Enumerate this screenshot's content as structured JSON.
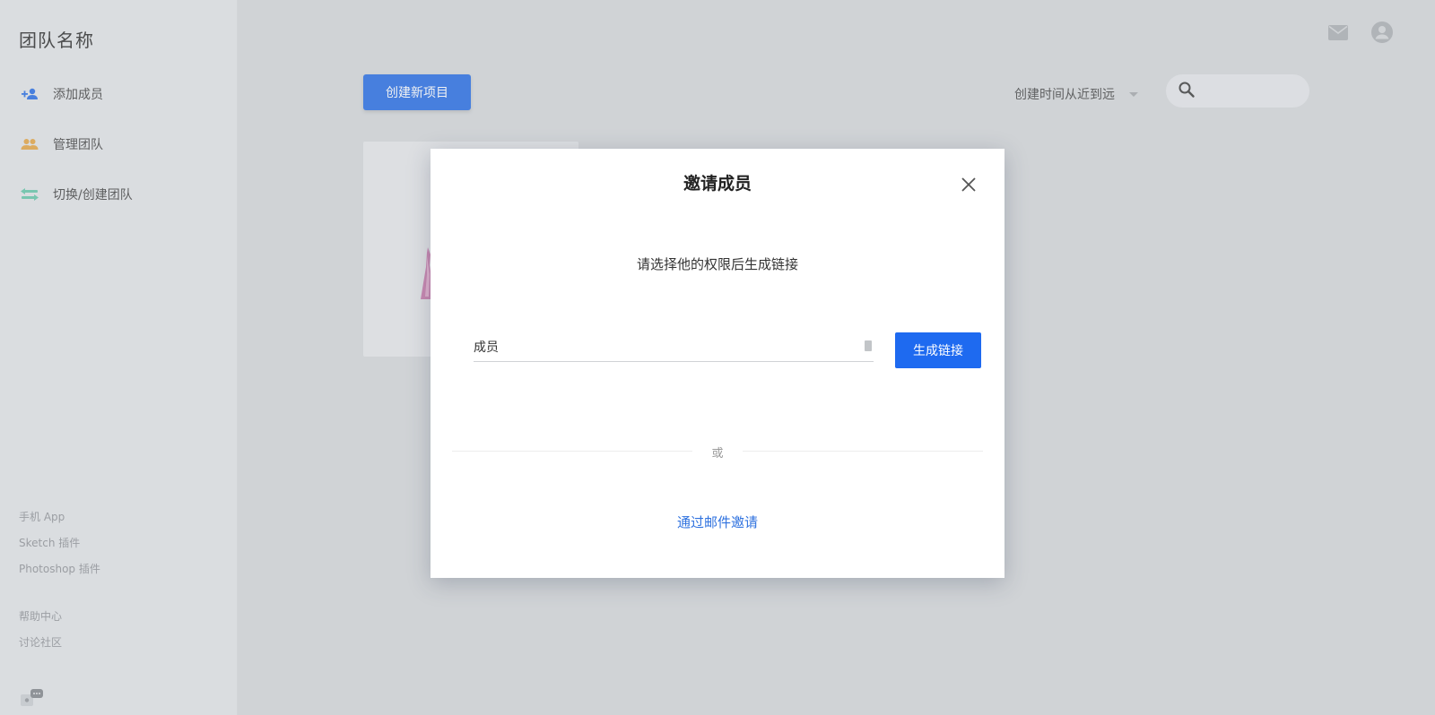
{
  "sidebar": {
    "team_name": "团队名称",
    "items": [
      {
        "label": "添加成员",
        "icon": "add-user-icon",
        "color": "#1d66e3"
      },
      {
        "label": "管理团队",
        "icon": "team-icon",
        "color": "#e3a13b"
      },
      {
        "label": "切换/创建团队",
        "icon": "switch-icon",
        "color": "#5fc4a6"
      }
    ],
    "footer_links": [
      "手机 App",
      "Sketch 插件",
      "Photoshop 插件"
    ],
    "help_links": [
      "帮助中心",
      "讨论社区"
    ]
  },
  "toolbar": {
    "create_label": "创建新项目",
    "sort_label": "创建时间从近到远",
    "search_placeholder": ""
  },
  "modal": {
    "title": "邀请成员",
    "subtitle": "请选择他的权限后生成链接",
    "role_value": "成员",
    "generate_label": "生成链接",
    "or_text": "或",
    "email_invite_label": "通过邮件邀请"
  },
  "colors": {
    "accent": "#1d66e3",
    "link": "#2f72df"
  }
}
